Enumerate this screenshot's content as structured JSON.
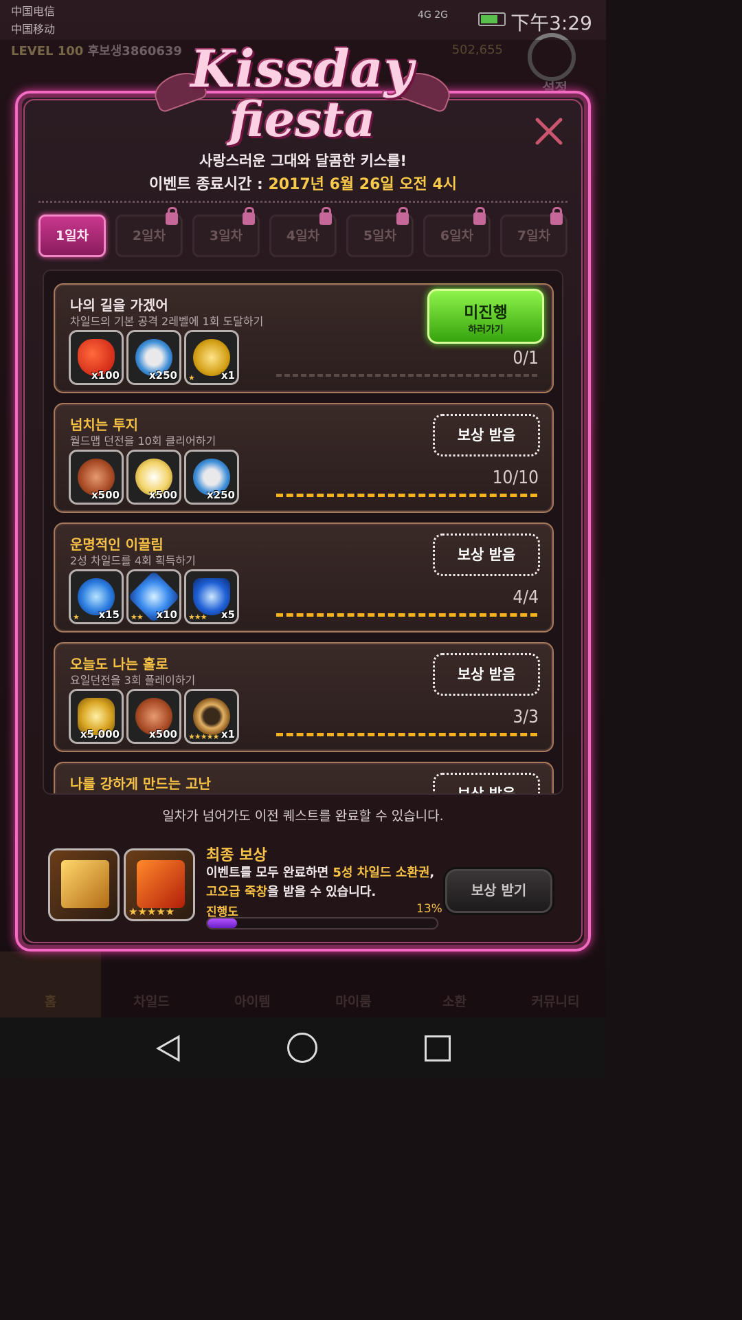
{
  "status_bar": {
    "carrier1": "中国电信",
    "carrier2": "中国移动",
    "network": "4G 2G",
    "time": "下午3:29"
  },
  "background": {
    "level_label": "LEVEL",
    "level": "100",
    "nickname": "후보생3860639",
    "gold": "502,655",
    "settings_label": "설정",
    "nav": [
      "홈",
      "차일드",
      "아이템",
      "마이룸",
      "소환",
      "커뮤니티"
    ]
  },
  "event": {
    "logo_line1": "Kissday",
    "logo_line2": "fiesta",
    "subtitle": "사랑스러운 그대와 달콤한 키스를!",
    "period_label": "이벤트 종료시간 : ",
    "period_value": "2017년 6월 26일 오전 4시"
  },
  "tabs": [
    {
      "label": "1일차",
      "active": true,
      "locked": false
    },
    {
      "label": "2일차",
      "active": false,
      "locked": true
    },
    {
      "label": "3일차",
      "active": false,
      "locked": true
    },
    {
      "label": "4일차",
      "active": false,
      "locked": true
    },
    {
      "label": "5일차",
      "active": false,
      "locked": true
    },
    {
      "label": "6일차",
      "active": false,
      "locked": true
    },
    {
      "label": "7일차",
      "active": false,
      "locked": true
    }
  ],
  "quests": [
    {
      "title": "나의 길을 가겠어",
      "desc": "차일드의 기본 공격 2레벨에 1회 도달하기",
      "progress": "0/1",
      "progress_fraction": 0,
      "button_main": "미진행",
      "button_sub": "하러가기",
      "rewards": [
        {
          "icon": "heart-icon",
          "qty": "x100",
          "stars": ""
        },
        {
          "icon": "wing-emblem-icon",
          "qty": "x250",
          "stars": ""
        },
        {
          "icon": "gold-medal-icon",
          "qty": "x1",
          "stars": "★"
        }
      ]
    },
    {
      "title": "넘치는 투지",
      "desc": "월드맵 던전을 10회 클리어하기",
      "progress": "10/10",
      "progress_fraction": 1,
      "button": "보상 받음",
      "rewards": [
        {
          "icon": "bronze-coin-icon",
          "qty": "x500",
          "stars": ""
        },
        {
          "icon": "silver-coin-icon",
          "qty": "x500",
          "stars": ""
        },
        {
          "icon": "wing-emblem-icon",
          "qty": "x250",
          "stars": ""
        }
      ]
    },
    {
      "title": "운명적인 이끌림",
      "desc": "2성 차일드를 4회 획득하기",
      "progress": "4/4",
      "progress_fraction": 1,
      "button": "보상 받음",
      "rewards": [
        {
          "icon": "blue-orb-icon",
          "qty": "x15",
          "stars": "★"
        },
        {
          "icon": "blue-crystal-icon",
          "qty": "x10",
          "stars": "★★"
        },
        {
          "icon": "blue-diamond-icon",
          "qty": "x5",
          "stars": "★★★"
        }
      ]
    },
    {
      "title": "오늘도 나는 홀로",
      "desc": "요일던전을 3회 플레이하기",
      "progress": "3/3",
      "progress_fraction": 1,
      "button": "보상 받음",
      "rewards": [
        {
          "icon": "gold-coins-icon",
          "qty": "x5,000",
          "stars": ""
        },
        {
          "icon": "bronze-coin-icon",
          "qty": "x500",
          "stars": ""
        },
        {
          "icon": "ring-icon",
          "qty": "x1",
          "stars": "★★★★★"
        }
      ]
    },
    {
      "title": "나를 강하게 만드는 고난",
      "desc": "",
      "progress": "",
      "progress_fraction": 0,
      "button": "보상 받음",
      "rewards": []
    }
  ],
  "footer": {
    "note": "일차가 넘어가도 이전 퀘스트를 완료할 수 있습니다.",
    "final_title": "최종 보상",
    "final_text_1": "이벤트를 모두 완료하면 ",
    "final_text_hl1": "5성 차일드 소환권",
    "final_text_2": ",",
    "final_text_hl2": "고오급 죽창",
    "final_text_3": "을 받을 수 있습니다.",
    "progress_label": "진행도",
    "progress_pct": "13%",
    "progress_value": 0.13,
    "claim_button": "보상 받기",
    "final_items": [
      {
        "icon": "summon-ticket-icon",
        "stars": ""
      },
      {
        "icon": "bamboo-spear-icon",
        "stars": "★★★★★"
      }
    ]
  },
  "colors": {
    "accent_pink": "#f36ac2",
    "gold_text": "#f7c245",
    "green_button": "#5adf2a",
    "progress_purple": "#8b2be2"
  }
}
